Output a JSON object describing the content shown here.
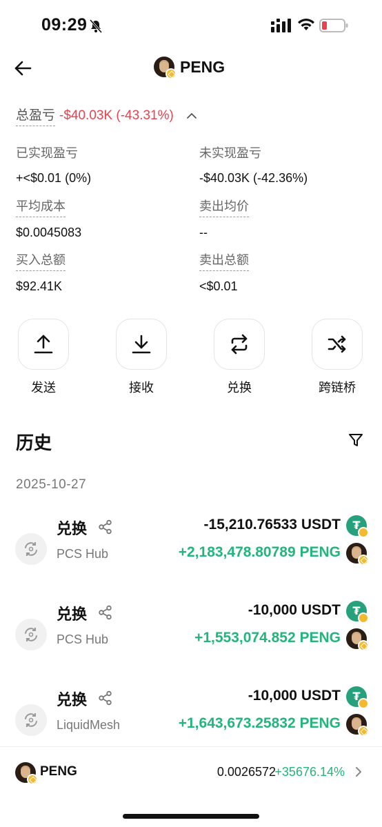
{
  "status": {
    "time": "09:29",
    "colors": {
      "battery_low": "#e8414f"
    }
  },
  "nav": {
    "title": "PENG",
    "back_icon": "arrow-left-icon"
  },
  "pnl": {
    "label": "总盈亏",
    "value": "-$40.03K (-43.31%)",
    "caret_icon": "chevron-up-icon"
  },
  "stats": {
    "realized": {
      "label": "已实现盈亏",
      "value": "+<$0.01 (0%)"
    },
    "unrealized": {
      "label": "未实现盈亏",
      "value": "-$40.03K (-42.36%)"
    },
    "avg_cost": {
      "label": "平均成本",
      "value": "$0.0045083"
    },
    "avg_sell": {
      "label": "卖出均价",
      "value": "--"
    },
    "total_buy": {
      "label": "买入总额",
      "value": "$92.41K"
    },
    "total_sell": {
      "label": "卖出总额",
      "value": "<$0.01"
    }
  },
  "actions": [
    {
      "label": "发送",
      "icon": "upload-icon"
    },
    {
      "label": "接收",
      "icon": "download-icon"
    },
    {
      "label": "兑换",
      "icon": "swap-icon"
    },
    {
      "label": "跨链桥",
      "icon": "bridge-shuffle-icon"
    }
  ],
  "history": {
    "title": "历史",
    "date": "2025-10-27",
    "items": [
      {
        "type": "兑换",
        "source": "PCS Hub",
        "out": "-15,210.76533 USDT",
        "in": "+2,183,478.80789 PENG"
      },
      {
        "type": "兑换",
        "source": "PCS Hub",
        "out": "-10,000 USDT",
        "in": "+1,553,074.852 PENG"
      },
      {
        "type": "兑换",
        "source": "LiquidMesh",
        "out": "-10,000 USDT",
        "in": "+1,643,673.25832 PENG"
      }
    ]
  },
  "bottom": {
    "name": "PENG",
    "price": "0.0026572",
    "change": "+35676.14%"
  },
  "colors": {
    "negative": "#e8414f",
    "positive": "#22b57c",
    "usdt": "#26a17b",
    "bnb": "#f3ba2f"
  }
}
